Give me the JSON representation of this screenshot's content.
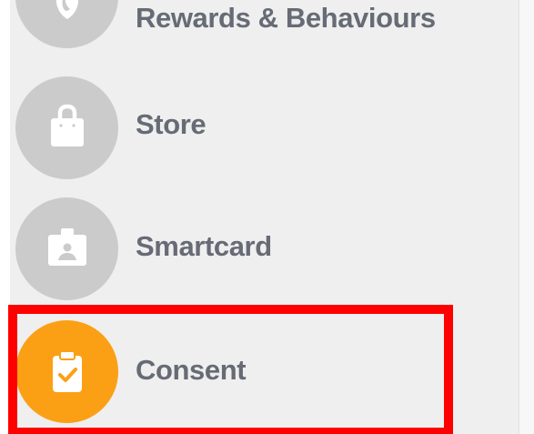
{
  "sidebar": {
    "items": [
      {
        "label": "Rewards & Behaviours",
        "icon": "rewards-icon",
        "active": false
      },
      {
        "label": "Store",
        "icon": "shopping-bag-icon",
        "active": false
      },
      {
        "label": "Smartcard",
        "icon": "id-badge-icon",
        "active": false
      },
      {
        "label": "Consent",
        "icon": "clipboard-check-icon",
        "active": true
      }
    ]
  },
  "colors": {
    "sidebar_background": "#efefef",
    "inactive_icon_circle": "#cbcbcb",
    "active_icon_circle": "#fba015",
    "label_text": "#666b75",
    "highlight_outline": "#ff0000"
  }
}
